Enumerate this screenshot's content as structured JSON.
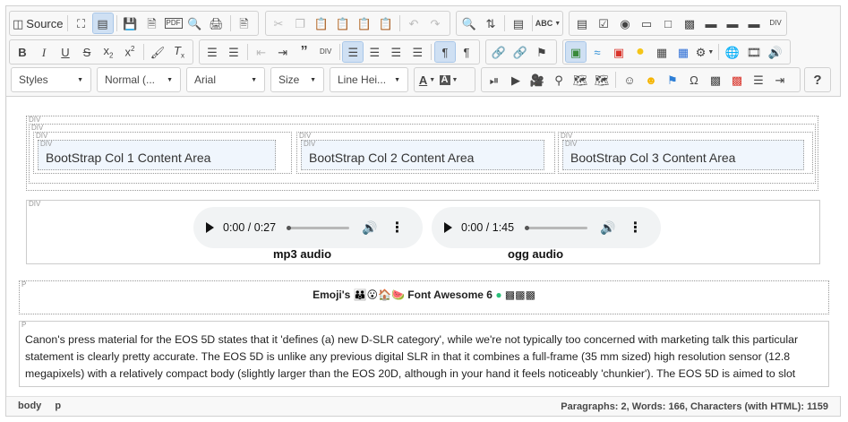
{
  "toolbar": {
    "source_label": "Source",
    "styles_combo": "Styles",
    "format_combo": "Normal (...",
    "font_combo": "Arial",
    "size_combo": "Size",
    "lineheight_combo": "Line Hei...",
    "help_label": "?"
  },
  "content": {
    "block_labels": {
      "div": "DIV",
      "p": "P"
    },
    "columns": [
      {
        "text": "BootStrap Col 1 Content Area"
      },
      {
        "text": "BootStrap Col 2 Content Area"
      },
      {
        "text": "BootStrap Col 3 Content Area"
      }
    ],
    "audio": [
      {
        "time": "0:00 / 0:27",
        "caption": "mp3 audio"
      },
      {
        "time": "0:00 / 1:45",
        "caption": "ogg audio"
      }
    ],
    "emoji_label": "Emoji's",
    "fontawesome_label": "Font Awesome 6",
    "paragraph": "Canon's press material for the EOS 5D states that it 'defines (a) new D-SLR category', while we're not typically too concerned with marketing talk this particular statement is clearly pretty accurate. The EOS 5D is unlike any previous digital SLR in that it combines a full-frame (35 mm sized) high resolution sensor (12.8 megapixels) with a relatively compact body (slightly larger than the EOS 20D, although in your hand it feels noticeably 'chunkier'). The EOS 5D is aimed to slot"
  },
  "statusbar": {
    "path": [
      "body",
      "p"
    ],
    "word_count": "Paragraphs: 2, Words: 166, Characters (with HTML): 1159"
  },
  "colors": {
    "active_button": "#cfe0f3",
    "border": "#d1d1d1",
    "toolbar_bg": "#f8f8f8"
  }
}
